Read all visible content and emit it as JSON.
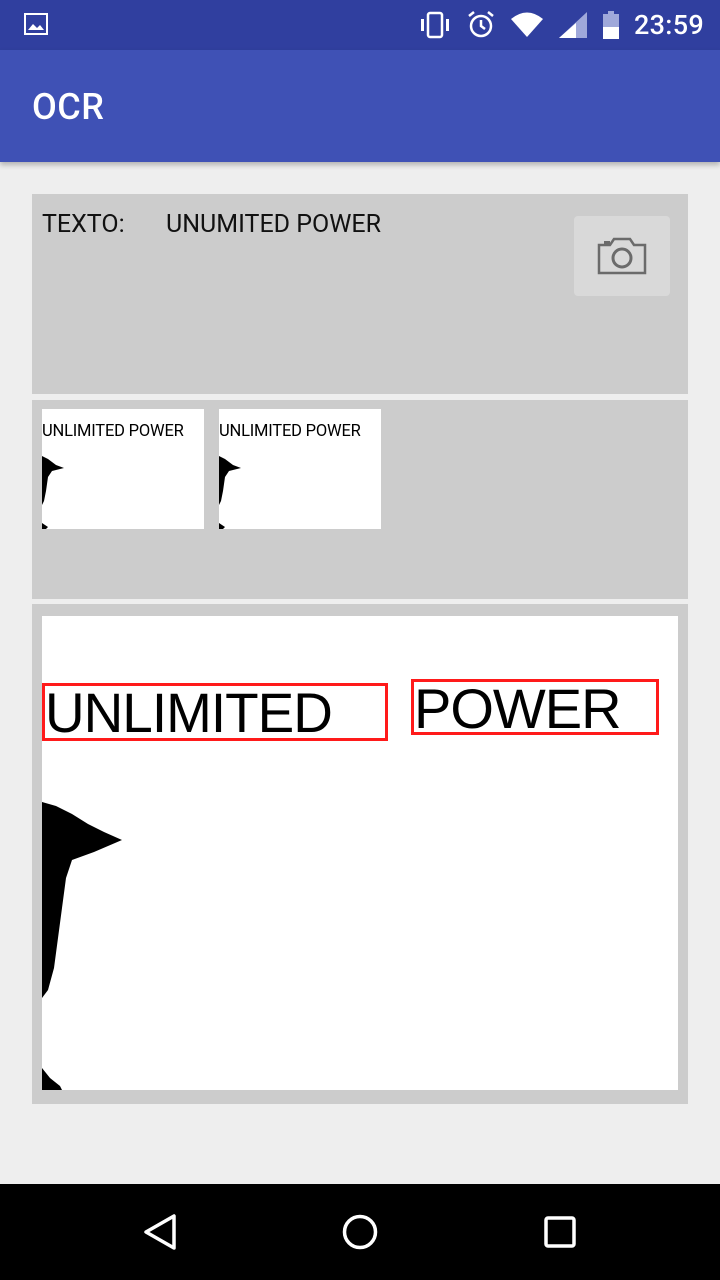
{
  "status_bar": {
    "time": "23:59",
    "icons": [
      "image-notification-icon",
      "vibrate-icon",
      "alarm-icon",
      "wifi-icon",
      "signal-icon",
      "battery-icon"
    ]
  },
  "app_bar": {
    "title": "OCR"
  },
  "text_panel": {
    "label": "TEXTO:",
    "value": "UNUMITED POWER",
    "camera_icon": "camera-icon"
  },
  "thumbnails": [
    {
      "text": "UNLIMITED POWER"
    },
    {
      "text": "UNLIMITED POWER"
    }
  ],
  "result": {
    "words": [
      "UNLIMITED",
      "POWER"
    ],
    "box_color": "#ff1a1a"
  },
  "colors": {
    "status_bar": "#303f9f",
    "app_bar": "#3f51b5",
    "panel": "#cccccc",
    "background": "#eeeeee"
  },
  "nav_bar": {
    "buttons": [
      "back-icon",
      "home-icon",
      "recents-icon"
    ]
  }
}
